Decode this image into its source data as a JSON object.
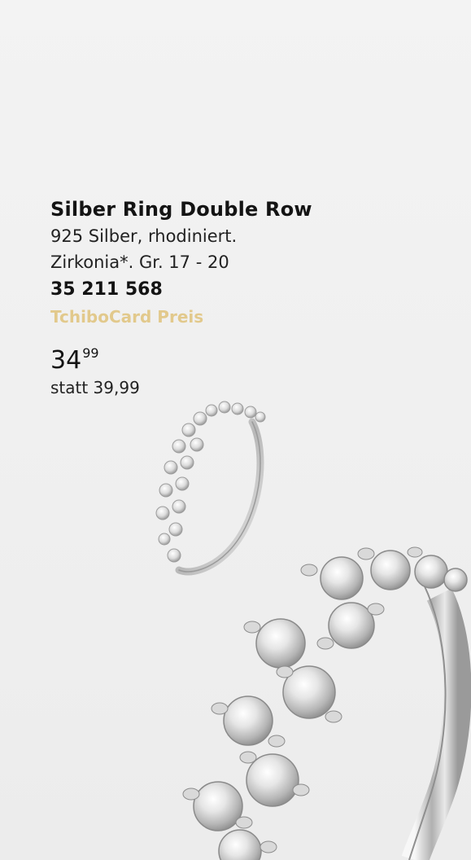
{
  "product": {
    "title": "Silber Ring Double Row",
    "desc_line1": "925 Silber, rhodiniert.",
    "desc_line2": "Zirkonia*. Gr. 17 - 20",
    "article_number": "35 211 568",
    "card_label": "TchiboCard Preis",
    "price_main": "34",
    "price_cents": "99",
    "old_price": "statt 39,99"
  },
  "colors": {
    "background": "#f2f2f2",
    "accent_gold": "#e2c98c",
    "text": "#141414"
  },
  "images": {
    "small_ring": "ring-icon",
    "large_ring": "ring-closeup-icon"
  }
}
